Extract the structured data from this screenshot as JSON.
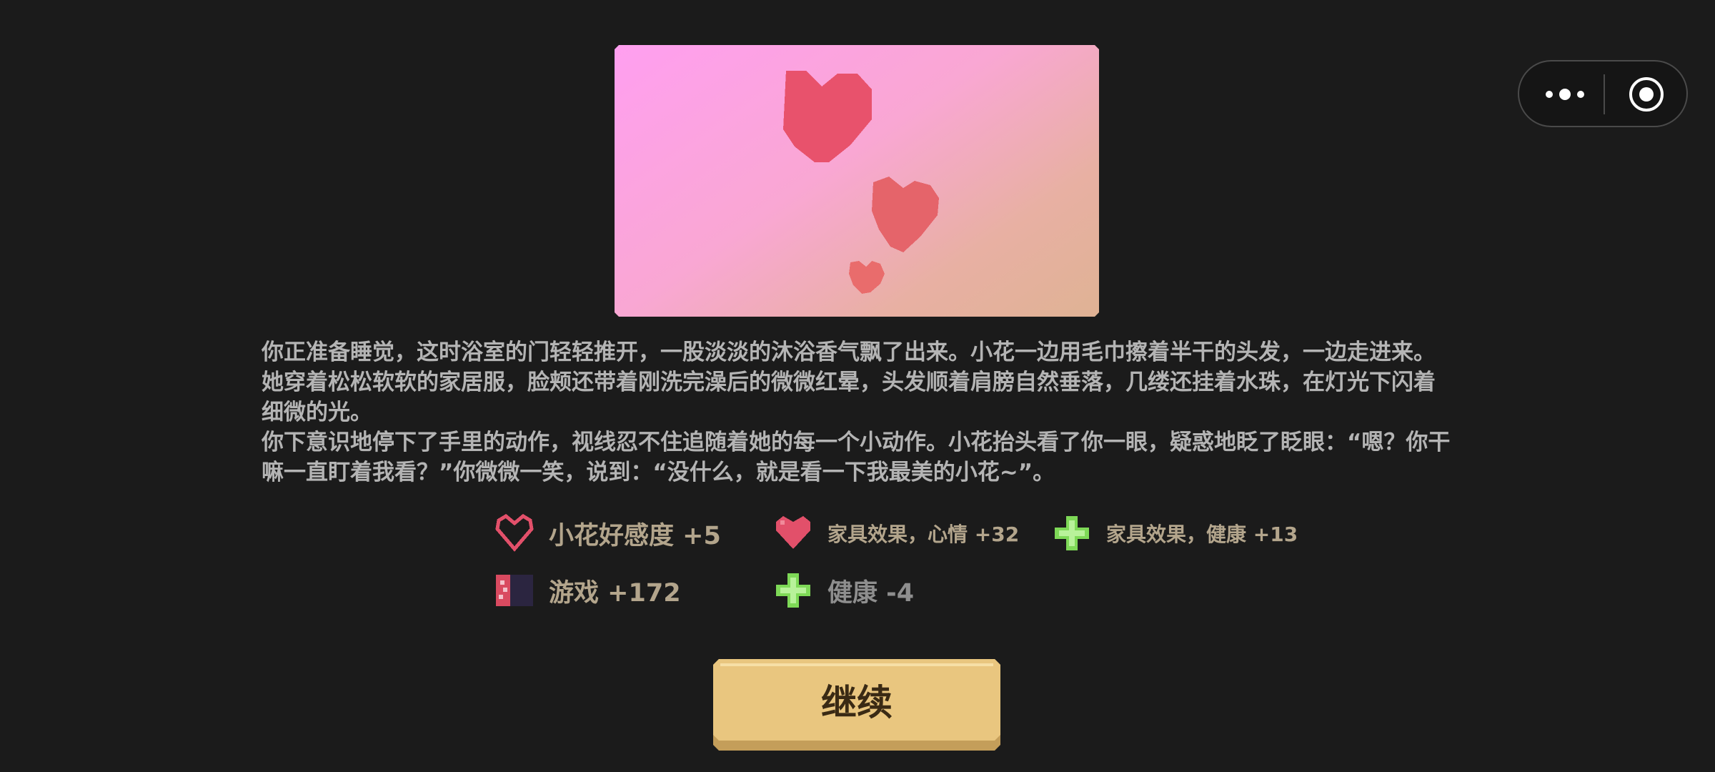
{
  "capsule": {
    "more_icon": "more-dots-icon",
    "target_icon": "target-circle-icon"
  },
  "scene": {
    "description_icon": "floating-hearts-illustration"
  },
  "story": {
    "paragraphs": [
      "你正准备睡觉，这时浴室的门轻轻推开，一股淡淡的沐浴香气飘了出来。小花一边用毛巾擦着半干的头发，一边走进来。她穿着松松软软的家居服，脸颊还带着刚洗完澡后的微微红晕，头发顺着肩膀自然垂落，几缕还挂着水珠，在灯光下闪着细微的光。",
      "你下意识地停下了手里的动作，视线忍不住追随着她的每一个小动作。小花抬头看了你一眼，疑惑地眨了眨眼：“嗯？你干嘛一直盯着我看？”你微微一笑，说到：“没什么，就是看一下我最美的小花~”。"
    ]
  },
  "stats": {
    "affection": {
      "label": "小花好感度 +5",
      "icon": "heart-outline-icon"
    },
    "furniture_mood": {
      "label": "家具效果，心情 +32",
      "icon": "heart-filled-icon"
    },
    "furniture_health": {
      "label": "家具效果，健康 +13",
      "icon": "green-cross-icon"
    },
    "game": {
      "label": "游戏 +172",
      "icon": "game-card-icon"
    },
    "health": {
      "label": "健康 -4",
      "icon": "green-cross-icon"
    }
  },
  "actions": {
    "continue_label": "继续"
  },
  "colors": {
    "background": "#1b1b1b",
    "text": "#b4b4b4",
    "stat_text": "#b3a58c",
    "button": "#e9c67f",
    "heart": "#e2506a",
    "cross": "#7ed957"
  }
}
